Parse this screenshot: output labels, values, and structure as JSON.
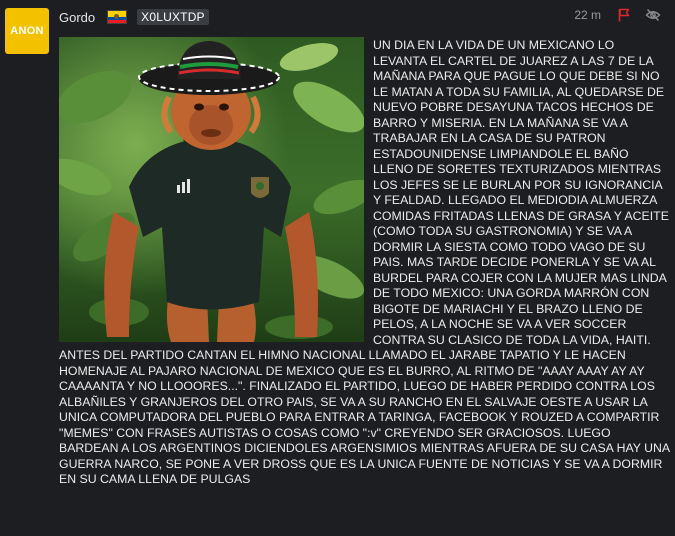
{
  "avatar": {
    "label": "ANON"
  },
  "header": {
    "username": "Gordo",
    "country_flag": "ecuador-flag-icon",
    "user_id": "X0LUXTDP"
  },
  "meta": {
    "time": "22 m",
    "report_icon": "flag-icon",
    "hide_icon": "eye-off-icon"
  },
  "colors": {
    "background": "#1c1e21",
    "avatar_bg": "#f3c100",
    "report_red": "#e0262b",
    "text": "#ececec"
  },
  "post": {
    "image": "orangutan-in-sombrero-and-mexico-jersey",
    "body": "UN DIA EN LA VIDA DE UN MEXICANO LO LEVANTA EL CARTEL DE JUAREZ A LAS 7 DE LA MAÑANA PARA QUE PAGUE LO QUE DEBE SI NO LE MATAN A TODA SU FAMILIA, AL QUEDARSE DE NUEVO POBRE DESAYUNA TACOS HECHOS DE BARRO Y MISERIA. EN LA MAÑANA SE VA A TRABAJAR EN LA CASA DE SU PATRON ESTADOUNIDENSE  LIMPIANDOLE EL BAÑO LLENO DE SORETES TEXTURIZADOS MIENTRAS LOS JEFES SE LE BURLAN POR SU IGNORANCIA Y FEALDAD. LLEGADO EL MEDIODIA ALMUERZA COMIDAS FRITADAS LLENAS DE GRASA Y ACEITE (COMO TODA SU GASTRONOMIA) Y SE VA A DORMIR LA SIESTA COMO TODO VAGO DE SU PAIS. MAS TARDE DECIDE PONERLA Y SE VA AL BURDEL PARA COJER CON LA MUJER MAS LINDA DE TODO MEXICO: UNA GORDA MARRÓN CON BIGOTE DE MARIACHI Y EL BRAZO LLENO DE PELOS, A LA NOCHE SE VA A VER SOCCER CONTRA SU CLASICO DE TODA LA VIDA, HAITI. ANTES DEL PARTIDO CANTAN EL HIMNO NACIONAL LLAMADO EL JARABE TAPATIO Y LE HACEN HOMENAJE AL PAJARO NACIONAL DE MEXICO QUE ES EL BURRO, AL RITMO DE \"AAAY AAAY AY AY CAAAANTA Y NO LLOOORES...\". FINALIZADO EL PARTIDO, LUEGO DE HABER PERDIDO CONTRA LOS ALBAÑILES Y GRANJEROS DEL OTRO PAIS, SE VA A SU RANCHO EN EL SALVAJE OESTE A USAR LA UNICA COMPUTADORA DEL PUEBLO PARA ENTRAR A TARINGA, FACEBOOK Y ROUZED A COMPARTIR \"MEMES\" CON FRASES AUTISTAS O COSAS COMO \":v\" CREYENDO SER GRACIOSOS. LUEGO BARDEAN A LOS ARGENTINOS DICIENDOLES ARGENSIMIOS MIENTRAS AFUERA DE SU CASA HAY UNA GUERRA NARCO, SE PONE A VER DROSS QUE ES LA UNICA FUENTE DE NOTICIAS Y SE VA A DORMIR EN SU CAMA LLENA DE PULGAS"
  }
}
